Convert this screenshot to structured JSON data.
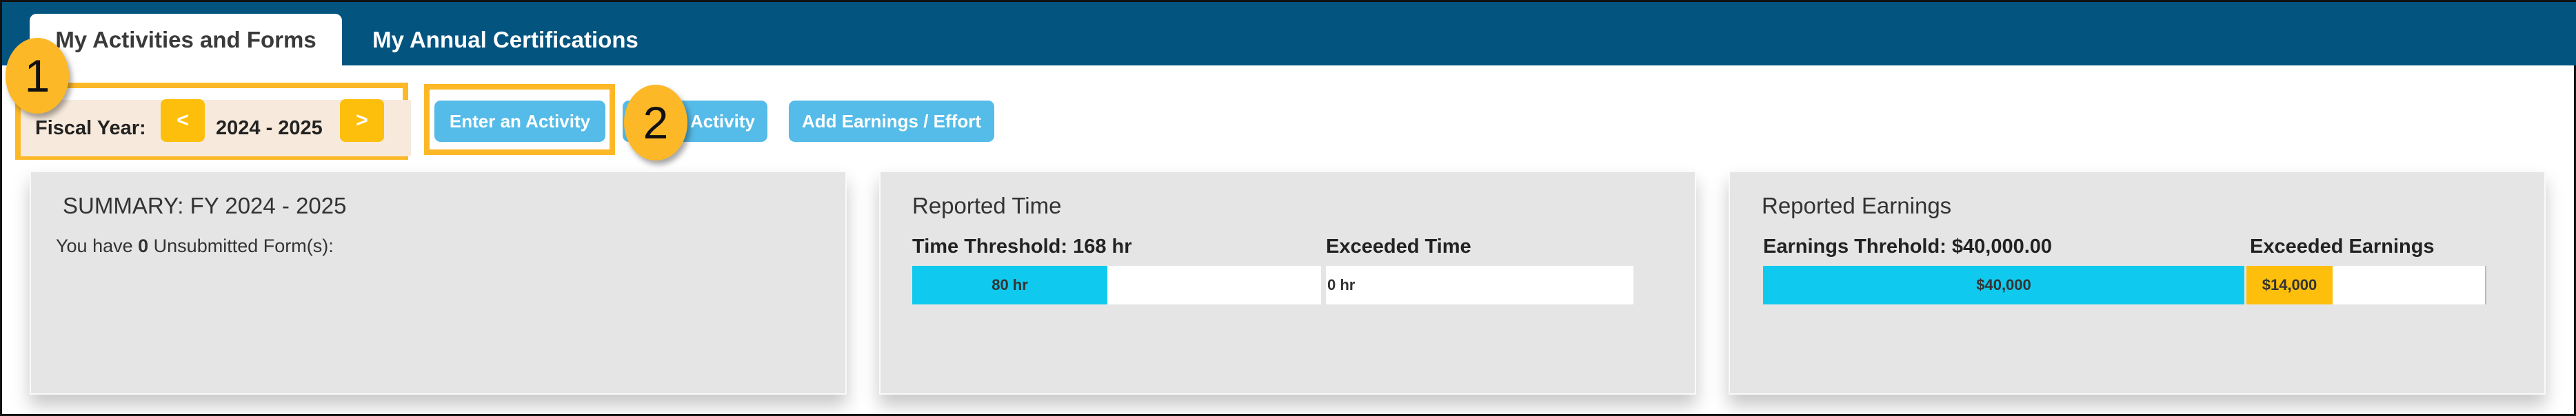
{
  "tabs": [
    {
      "label": "My Activities and Forms",
      "active": true
    },
    {
      "label": "My Annual Certifications",
      "active": false
    }
  ],
  "fiscal_year": {
    "label": "Fiscal Year:",
    "value": "2024 - 2025",
    "prev": "<",
    "next": ">"
  },
  "toolbar": {
    "enter_activity": "Enter an Activity",
    "activity": "Activity",
    "add_earnings": "Add Earnings / Effort"
  },
  "callouts": [
    "1",
    "2"
  ],
  "summary": {
    "title": "SUMMARY: FY 2024 - 2025",
    "text_pre": "You have ",
    "count": "0",
    "text_post": " Unsubmitted Form(s):"
  },
  "reported_time": {
    "title": "Reported Time",
    "threshold_label": "Time Threshold: 168 hr",
    "exceeded_label": "Exceeded Time",
    "reported_value": "80 hr",
    "exceeded_value": "0 hr",
    "reported_hours": 80,
    "threshold_hours": 168
  },
  "reported_earnings": {
    "title": "Reported Earnings",
    "threshold_label": "Earnings Threhold: $40,000.00",
    "exceeded_label": "Exceeded Earnings",
    "reported_value": "$40,000",
    "exceeded_value": "$14,000"
  },
  "colors": {
    "header": "#03547f",
    "button": "#55bbe8",
    "highlight": "#fdb827",
    "bar_fill": "#0fcaee",
    "exceeded_fill": "#fdbf0b"
  }
}
